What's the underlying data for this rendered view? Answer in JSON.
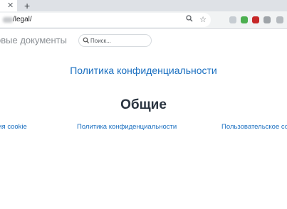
{
  "browser": {
    "close_glyph": "✕",
    "new_tab_glyph": "+",
    "url": "/legal/",
    "icons": [
      "zoom-icon",
      "bookmark-star-icon"
    ],
    "extension_colors": [
      "#a8c7a0",
      "#4caf50",
      "#c62828",
      "#9e9e9e"
    ]
  },
  "site": {
    "title": "овые документы",
    "search_placeholder": "Поиск..."
  },
  "main": {
    "heading_link": "Политика конфиденциальности",
    "section_title": "Общие",
    "links": [
      "ния cookie",
      "Политика конфиденциальности",
      "Пользовательское со"
    ]
  },
  "colors": {
    "link": "#1a6fc0",
    "heading": "#2a3440",
    "muted_title": "#8a8f94"
  }
}
